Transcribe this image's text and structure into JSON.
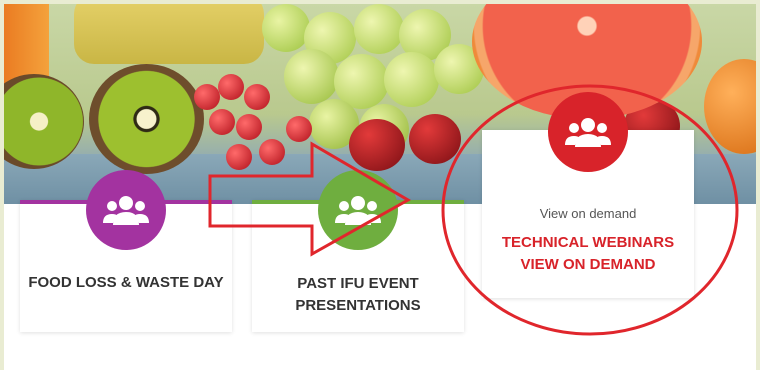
{
  "cards": [
    {
      "title": "FOOD LOSS & WASTE DAY",
      "icon": "users-icon",
      "color": "#a333a0"
    },
    {
      "title_line1": "PAST IFU EVENT",
      "title_line2": "PRESENTATIONS",
      "icon": "users-icon",
      "color": "#6fae3f"
    },
    {
      "subtitle": "View on demand",
      "cta_line1": "TECHNICAL WEBINARS",
      "cta_line2": "VIEW ON DEMAND",
      "icon": "users-icon",
      "color": "#d8232a"
    }
  ],
  "annotation": {
    "color": "#e0262c",
    "shapes": [
      "arrow",
      "ellipse"
    ]
  }
}
